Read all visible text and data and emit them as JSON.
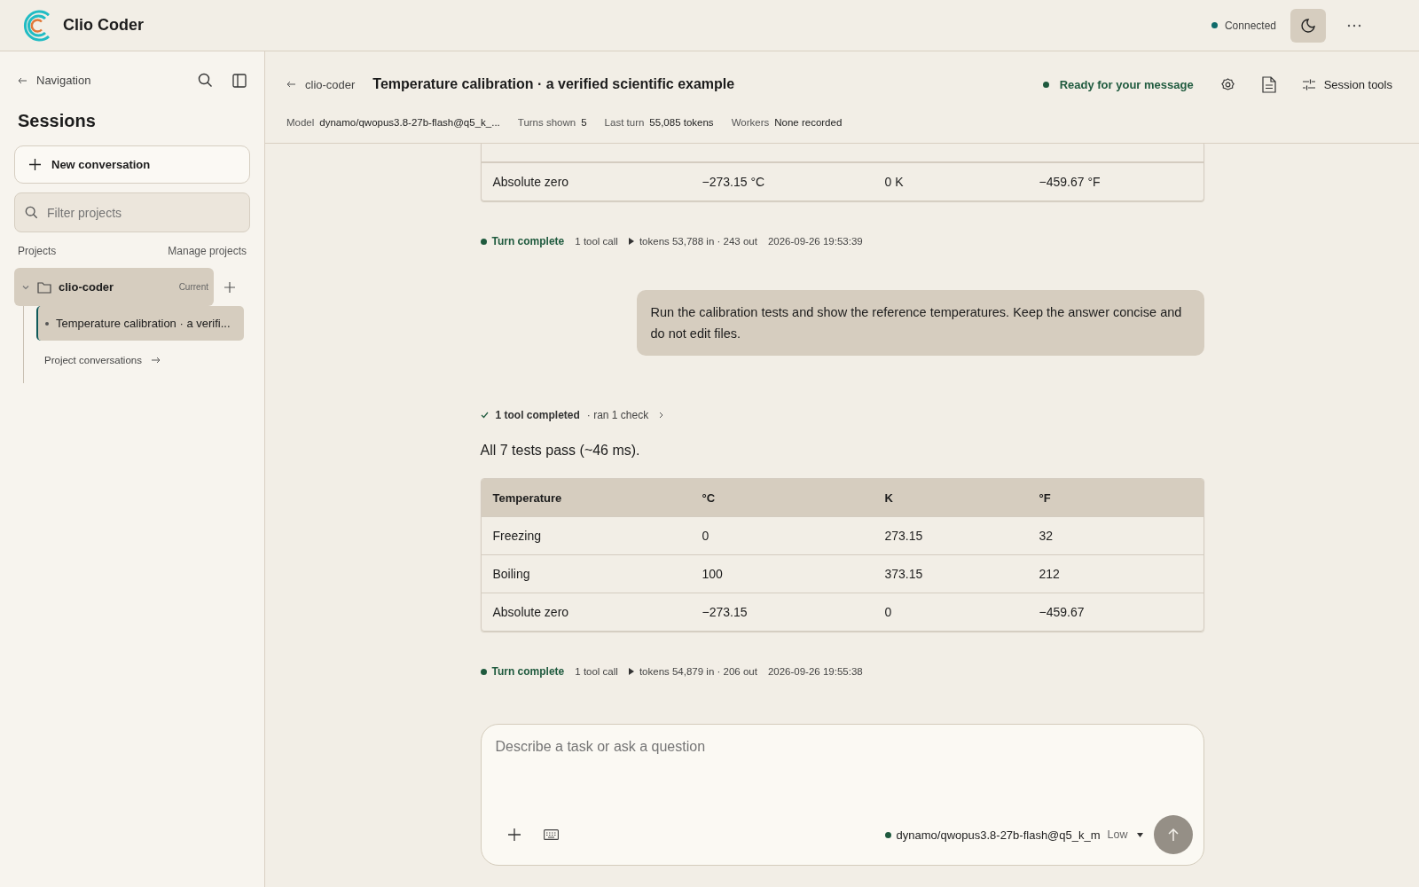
{
  "app": {
    "name": "Clio Coder",
    "connection": {
      "label": "Connected",
      "on": true
    }
  },
  "sidebar": {
    "nav_label": "Navigation",
    "title": "Sessions",
    "new_button": "New conversation",
    "filter_placeholder": "Filter projects",
    "projects_label": "Projects",
    "manage_label": "Manage projects",
    "projects": [
      {
        "name": "clio-coder",
        "badge": "Current",
        "expanded": true,
        "children": [
          {
            "title": "Temperature calibration · a verifi...",
            "selected": true
          }
        ],
        "footer_link": "Project conversations"
      }
    ]
  },
  "conversation": {
    "back_label": "clio-coder",
    "title": "Temperature calibration · a verified scientific example",
    "status": "Ready for your message",
    "session_tools": "Session tools",
    "meta": [
      {
        "label": "Model",
        "value": "dynamo/qwopus3.8-27b-flash@q5_k_..."
      },
      {
        "label": "Turns shown",
        "value": "5"
      },
      {
        "label": "Last turn",
        "value": "55,085 tokens"
      },
      {
        "label": "Workers",
        "value": "None recorded"
      }
    ]
  },
  "messages": [
    {
      "kind": "table",
      "rows": [
        [
          "Absolute zero",
          "−273.15 °C",
          "0 K",
          "−459.67 °F"
        ]
      ]
    },
    {
      "kind": "turn",
      "status": "Turn complete",
      "calls": "1 tool call",
      "tokens": "tokens 53,788 in · 243 out",
      "time": "2026-09-26 19:53:39"
    },
    {
      "kind": "user",
      "text": "Run the calibration tests and show the reference temperatures. Keep the answer concise and do not edit files."
    },
    {
      "kind": "tool",
      "summary": "1 tool completed",
      "detail": "· ran 1 check"
    },
    {
      "kind": "text",
      "text": "All 7 tests pass (~46 ms)."
    },
    {
      "kind": "table",
      "columns": [
        "Temperature",
        "°C",
        "K",
        "°F"
      ],
      "rows": [
        [
          "Freezing",
          "0",
          "273.15",
          "32"
        ],
        [
          "Boiling",
          "100",
          "373.15",
          "212"
        ],
        [
          "Absolute zero",
          "−273.15",
          "0",
          "−459.67"
        ]
      ]
    },
    {
      "kind": "turn",
      "status": "Turn complete",
      "calls": "1 tool call",
      "tokens": "tokens 54,879 in · 206 out",
      "time": "2026-09-26 19:55:38"
    }
  ],
  "composer": {
    "placeholder": "Describe a task or ask a question",
    "model": "dynamo/qwopus3.8-27b-flash@q5_k_m",
    "effort": "Low"
  }
}
